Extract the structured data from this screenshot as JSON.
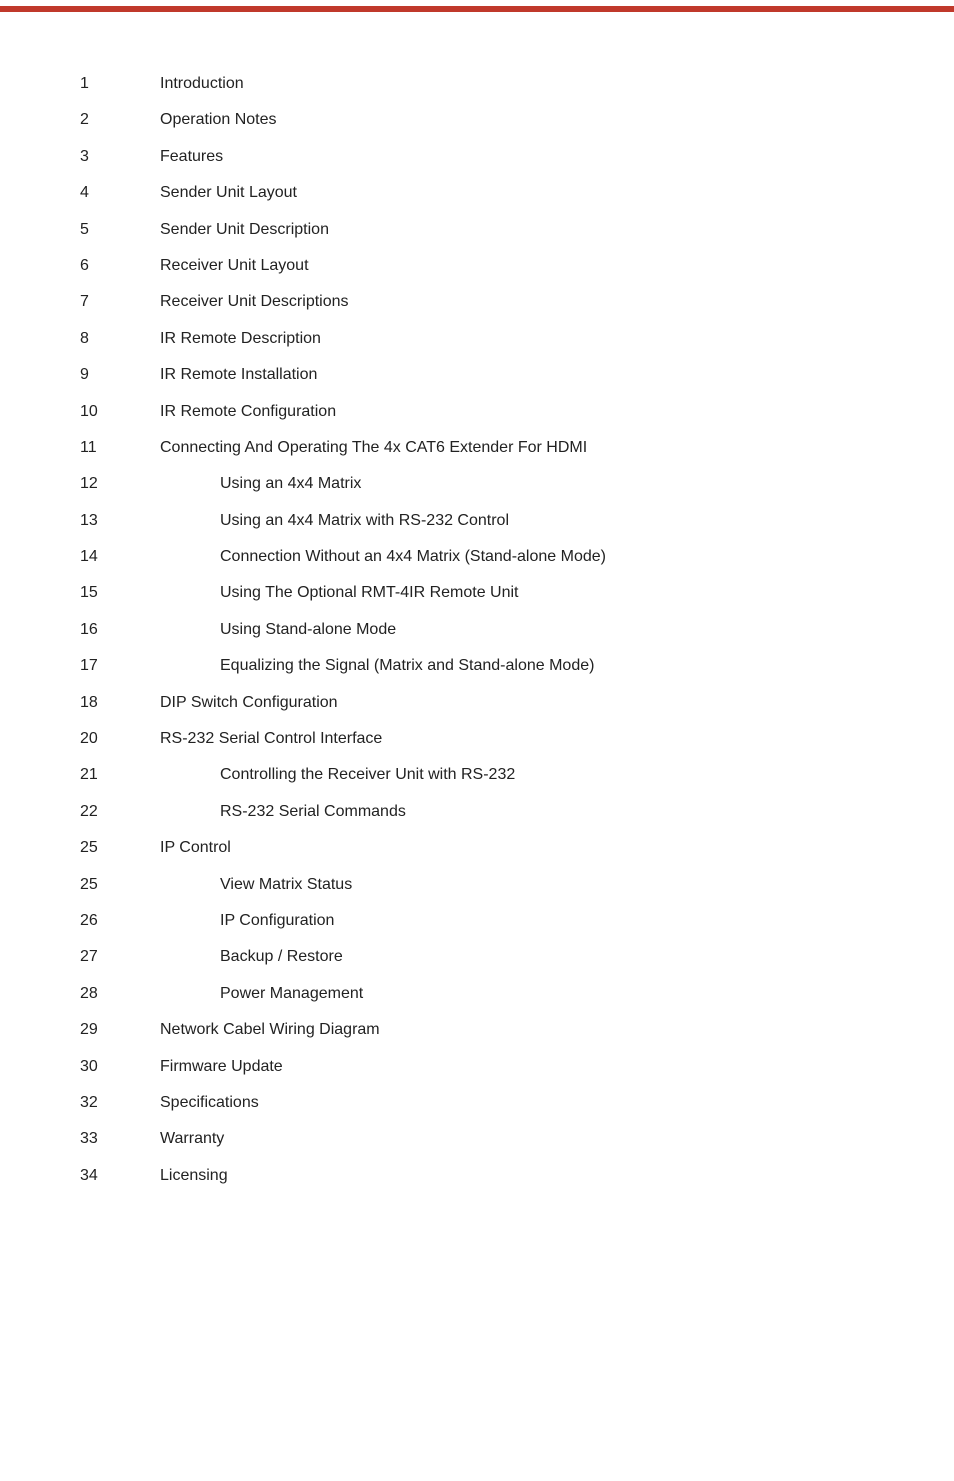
{
  "topbar": {
    "color": "#c0392b"
  },
  "toc": {
    "items": [
      {
        "num": "1",
        "label": "Introduction",
        "indent": 0
      },
      {
        "num": "2",
        "label": "Operation Notes",
        "indent": 0
      },
      {
        "num": "3",
        "label": "Features",
        "indent": 0
      },
      {
        "num": "4",
        "label": "Sender Unit Layout",
        "indent": 0
      },
      {
        "num": "5",
        "label": "Sender Unit Description",
        "indent": 0
      },
      {
        "num": "6",
        "label": "Receiver Unit Layout",
        "indent": 0
      },
      {
        "num": "7",
        "label": "Receiver Unit Descriptions",
        "indent": 0
      },
      {
        "num": "8",
        "label": "IR Remote Description",
        "indent": 0
      },
      {
        "num": "9",
        "label": "IR Remote Installation",
        "indent": 0
      },
      {
        "num": "10",
        "label": "IR Remote Configuration",
        "indent": 0
      },
      {
        "num": "11",
        "label": "Connecting And Operating The 4x CAT6 Extender For HDMI",
        "indent": 0
      },
      {
        "num": "12",
        "label": "Using an 4x4 Matrix",
        "indent": 1
      },
      {
        "num": "13",
        "label": "Using an 4x4 Matrix with RS-232 Control",
        "indent": 1
      },
      {
        "num": "14",
        "label": "Connection Without an 4x4 Matrix (Stand-alone Mode)",
        "indent": 1
      },
      {
        "num": "15",
        "label": "Using The Optional RMT-4IR Remote Unit",
        "indent": 1
      },
      {
        "num": "16",
        "label": "Using Stand-alone Mode",
        "indent": 1
      },
      {
        "num": "17",
        "label": "Equalizing the Signal (Matrix and Stand-alone Mode)",
        "indent": 1
      },
      {
        "num": "18",
        "label": "DIP Switch Configuration",
        "indent": 0
      },
      {
        "num": "20",
        "label": "RS-232 Serial Control Interface",
        "indent": 0
      },
      {
        "num": "21",
        "label": "Controlling the Receiver Unit with RS-232",
        "indent": 1
      },
      {
        "num": "22",
        "label": "RS-232 Serial Commands",
        "indent": 1
      },
      {
        "num": "25",
        "label": "IP Control",
        "indent": 0
      },
      {
        "num": "25",
        "label": "View Matrix Status",
        "indent": 1
      },
      {
        "num": "26",
        "label": "IP Configuration",
        "indent": 1
      },
      {
        "num": "27",
        "label": "Backup / Restore",
        "indent": 1
      },
      {
        "num": "28",
        "label": "Power Management",
        "indent": 1
      },
      {
        "num": "29",
        "label": "Network Cabel Wiring Diagram",
        "indent": 0
      },
      {
        "num": "30",
        "label": "Firmware Update",
        "indent": 0
      },
      {
        "num": "32",
        "label": "Specifications",
        "indent": 0
      },
      {
        "num": "33",
        "label": "Warranty",
        "indent": 0
      },
      {
        "num": "34",
        "label": "Licensing",
        "indent": 0
      }
    ]
  }
}
